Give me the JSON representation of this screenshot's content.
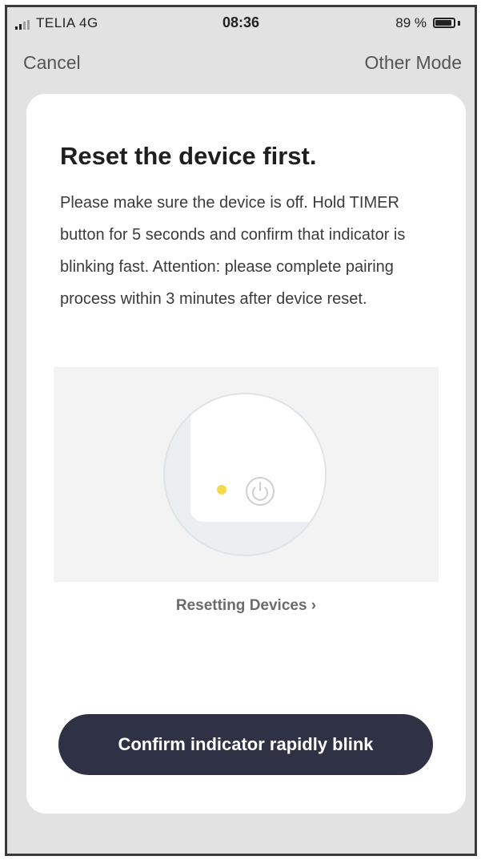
{
  "status_bar": {
    "carrier": "TELIA 4G",
    "time": "08:36",
    "battery": "89 %",
    "battery_level": 0.89
  },
  "nav": {
    "cancel_label": "Cancel",
    "other_mode_label": "Other Mode"
  },
  "card": {
    "title": "Reset the device first.",
    "description": "Please make sure the device is off. Hold TIMER button for 5 seconds and confirm that indicator is blinking fast. Attention: please complete pairing process within 3 minutes after device reset.",
    "illustration": {
      "indicator_icon": "yellow-dot",
      "button_icon": "power-icon",
      "indicator_color": "#f6d84a"
    },
    "reset_link": "Resetting Devices ›",
    "confirm_button": "Confirm indicator rapidly blink"
  },
  "colors": {
    "primary_button": "#2f3145",
    "background": "#e2e2e2"
  }
}
